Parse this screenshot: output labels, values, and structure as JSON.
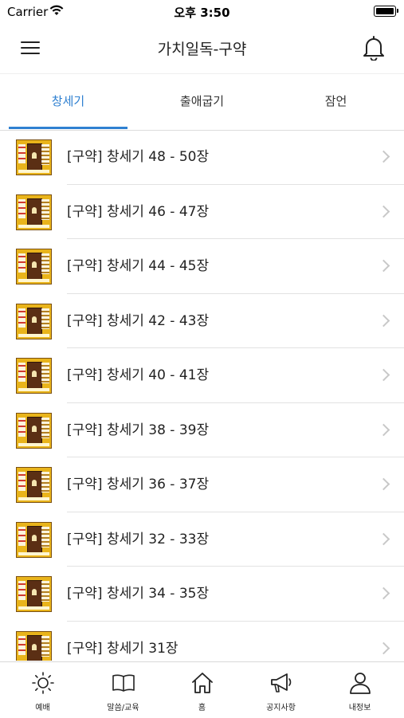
{
  "status": {
    "carrier": "Carrier",
    "time": "오후 3:50"
  },
  "nav": {
    "title": "가치일독-구약",
    "menu_icon": "hamburger-menu-icon",
    "bell_icon": "bell-icon"
  },
  "tabs": [
    {
      "label": "창세기",
      "active": true
    },
    {
      "label": "출애굽기",
      "active": false
    },
    {
      "label": "잠언",
      "active": false
    }
  ],
  "colors": {
    "accent": "#2f80d1",
    "thumbnail": "#e9b41b"
  },
  "list": [
    {
      "title": "[구약] 창세기 48 - 50장"
    },
    {
      "title": "[구약] 창세기 46 - 47장"
    },
    {
      "title": "[구약] 창세기 44 - 45장"
    },
    {
      "title": "[구약] 창세기 42 - 43장"
    },
    {
      "title": "[구약] 창세기 40 - 41장"
    },
    {
      "title": "[구약] 창세기 38 - 39장"
    },
    {
      "title": "[구약] 창세기 36 - 37장"
    },
    {
      "title": "[구약] 창세기 32 - 33장"
    },
    {
      "title": "[구약] 창세기 34 - 35장"
    },
    {
      "title": "[구약] 창세기 31장"
    }
  ],
  "tabbar": [
    {
      "label": "예배",
      "icon": "sun-icon"
    },
    {
      "label": "말씀/교육",
      "icon": "book-icon"
    },
    {
      "label": "홈",
      "icon": "home-icon"
    },
    {
      "label": "공지사항",
      "icon": "megaphone-icon"
    },
    {
      "label": "내정보",
      "icon": "user-icon"
    }
  ]
}
